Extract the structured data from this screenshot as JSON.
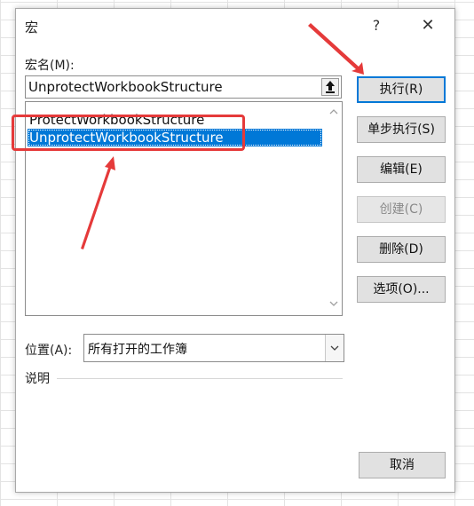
{
  "dialog": {
    "title": "宏",
    "help_label": "?",
    "close_label": "✕"
  },
  "macro_name": {
    "label": "宏名(M):",
    "value": "UnprotectWorkbookStructure"
  },
  "macro_list": {
    "items": [
      {
        "label": "ProtectWorkbookStructure",
        "selected": false
      },
      {
        "label": "UnprotectWorkbookStructure",
        "selected": true
      }
    ]
  },
  "buttons": {
    "run": "执行(R)",
    "step_into": "单步执行(S)",
    "edit": "编辑(E)",
    "create": "创建(C)",
    "delete": "删除(D)",
    "options": "选项(O)...",
    "cancel": "取消"
  },
  "location": {
    "label": "位置(A):",
    "selected": "所有打开的工作簿"
  },
  "description": {
    "label": "说明"
  },
  "colors": {
    "accent": "#0078d7",
    "annotation_red": "#e53a3a"
  },
  "icons": {
    "upload": "upload-arrow-icon",
    "scroll_up": "chevron-up-icon",
    "scroll_down": "chevron-down-icon",
    "combo": "chevron-down-icon"
  }
}
